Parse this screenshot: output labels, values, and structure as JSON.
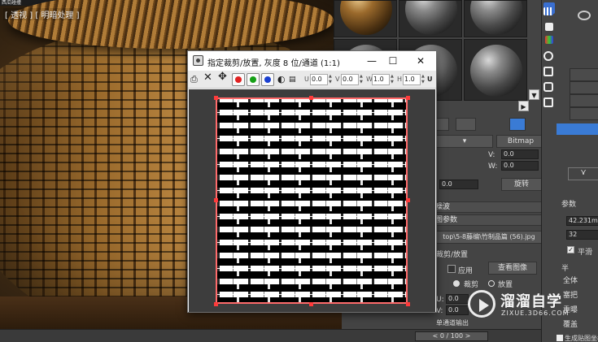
{
  "viewport": {
    "top_label": "西瓜碰撞",
    "label": "[ 透视 ] [ 明暗处理 ]"
  },
  "dialog": {
    "title": "指定裁剪/放置, 灰度 8 位/通道 (1:1)",
    "min_glyph": "—",
    "max_glyph": "☐",
    "close_glyph": "✕",
    "u_label": "U",
    "u_value": "0.0",
    "v_label": "V",
    "v_value": "0.0",
    "w_label": "W",
    "w_value": "1.0",
    "h_label": "H",
    "h_value": "1.0",
    "tail_label": "U",
    "channels": {
      "red": "#e02020",
      "green": "#16a016",
      "blue": "#1a3fd0"
    }
  },
  "params": {
    "bitmap_label": "Bitmap",
    "v_label": "V:",
    "v_value": "0.0",
    "w_label": "W:",
    "w_value": "0.0",
    "spin_value": "0.0",
    "rotate_button": "旋转",
    "noise_rollout": "噪波",
    "bitmap_params_rollout": "图参数",
    "path_text": "top\\5-8藤编\\竹制品篇 (56).jpg",
    "crop_section": "裁剪/放置",
    "apply_label": "应用",
    "view_image_button": "查看图像",
    "crop_label": "裁剪",
    "place_label": "放置",
    "u_label": "U:",
    "u_value": "0.0",
    "v2_label": "V:",
    "v2_value": "0.0",
    "bottom_text": "单通道输出"
  },
  "cmd_panel": {
    "params_title": "参数",
    "radius_value": "42.231m",
    "segments_value": "32",
    "smooth_label": "平滑",
    "hemi_label": "半",
    "items": [
      "全体",
      "塞把",
      "重曝",
      "覆盖"
    ],
    "bottom_label": "生成贴图坐标"
  },
  "watermark": {
    "title": "溜溜自学",
    "subtitle": "ZIXUE.3D66.COM"
  },
  "timeline": {
    "frame": "< 0 / 100 >"
  }
}
